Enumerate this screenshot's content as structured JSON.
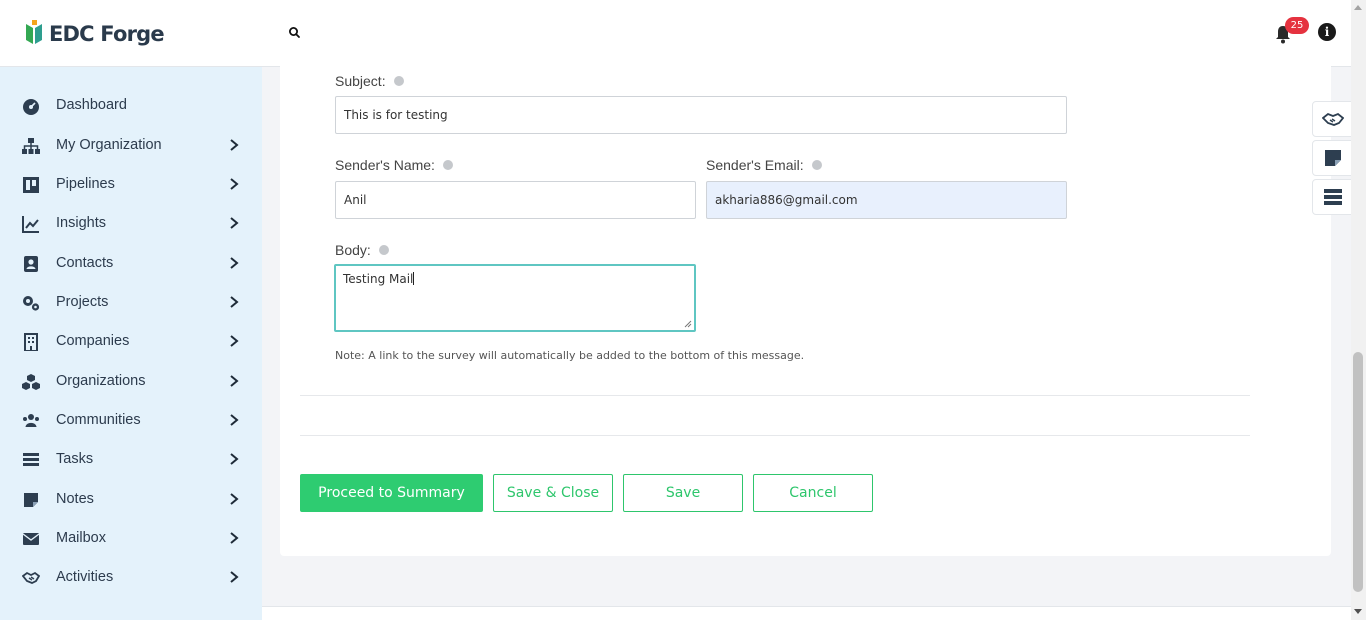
{
  "brand": {
    "name": "EDC Forge"
  },
  "header": {
    "notifications_count": "25",
    "info_glyph": "i"
  },
  "sidebar": {
    "items": [
      {
        "label": "Dashboard",
        "icon": "dashboard-icon",
        "has_submenu": false
      },
      {
        "label": "My Organization",
        "icon": "org-chart-icon",
        "has_submenu": true
      },
      {
        "label": "Pipelines",
        "icon": "pipeline-icon",
        "has_submenu": true
      },
      {
        "label": "Insights",
        "icon": "chart-line-icon",
        "has_submenu": true
      },
      {
        "label": "Contacts",
        "icon": "contact-book-icon",
        "has_submenu": true
      },
      {
        "label": "Projects",
        "icon": "gears-icon",
        "has_submenu": true
      },
      {
        "label": "Companies",
        "icon": "building-icon",
        "has_submenu": true
      },
      {
        "label": "Organizations",
        "icon": "cubes-icon",
        "has_submenu": true
      },
      {
        "label": "Communities",
        "icon": "users-icon",
        "has_submenu": true
      },
      {
        "label": "Tasks",
        "icon": "tasks-icon",
        "has_submenu": true
      },
      {
        "label": "Notes",
        "icon": "sticky-note-icon",
        "has_submenu": true
      },
      {
        "label": "Mailbox",
        "icon": "envelope-icon",
        "has_submenu": true
      },
      {
        "label": "Activities",
        "icon": "handshake-icon",
        "has_submenu": true
      }
    ]
  },
  "form": {
    "subject_label": "Subject:",
    "subject_value": "This is for testing",
    "sender_name_label": "Sender's Name:",
    "sender_name_value": "Anil",
    "sender_email_label": "Sender's Email:",
    "sender_email_value": "akharia886@gmail.com",
    "body_label": "Body:",
    "body_value": "Testing Mail",
    "note": "Note: A link to the survey will automatically be added to the bottom of this message."
  },
  "actions": {
    "proceed_label": "Proceed to Summary",
    "save_close_label": "Save & Close",
    "save_label": "Save",
    "cancel_label": "Cancel"
  },
  "colors": {
    "accent": "#2ecc71",
    "sidebar_bg": "#e4f2fb",
    "badge": "#e5323f",
    "focus_border": "#5fc6c2",
    "autofill_bg": "#e8f0fd"
  }
}
